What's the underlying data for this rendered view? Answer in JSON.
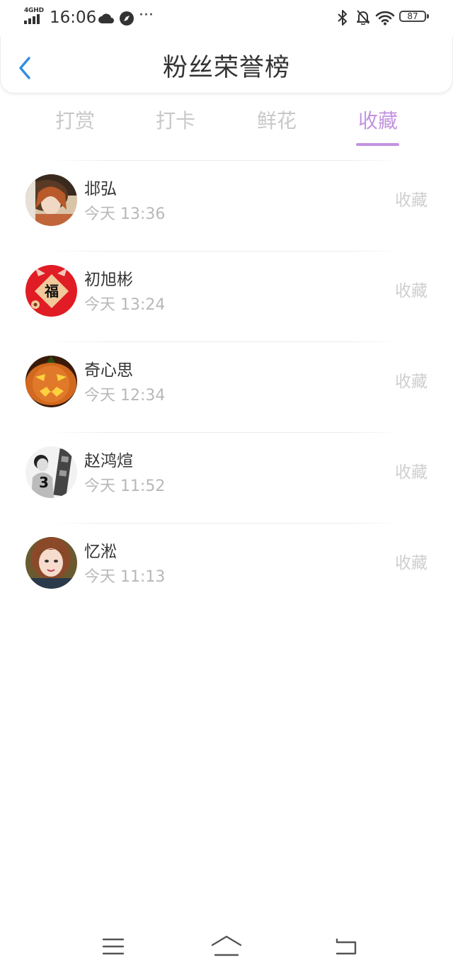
{
  "status_bar": {
    "network": "4GHD",
    "time": "16:06",
    "dots": "···",
    "battery": "87"
  },
  "header": {
    "title": "粉丝荣誉榜"
  },
  "tabs": [
    {
      "label": "打赏",
      "active": false
    },
    {
      "label": "打卡",
      "active": false
    },
    {
      "label": "鲜花",
      "active": false
    },
    {
      "label": "收藏",
      "active": true
    }
  ],
  "list": [
    {
      "name": "邶弘",
      "time": "今天 13:36",
      "action": "收藏"
    },
    {
      "name": "初旭彬",
      "time": "今天 13:24",
      "action": "收藏"
    },
    {
      "name": "奇心思",
      "time": "今天 12:34",
      "action": "收藏"
    },
    {
      "name": "赵鸿煊",
      "time": "今天 11:52",
      "action": "收藏"
    },
    {
      "name": "忆淞",
      "time": "今天 11:13",
      "action": "收藏"
    }
  ],
  "avatar_text": {
    "fu": "福"
  },
  "colors": {
    "accent": "#c193e0",
    "back_arrow": "#2f8fe0",
    "inactive_tab": "#c8c8c8"
  }
}
